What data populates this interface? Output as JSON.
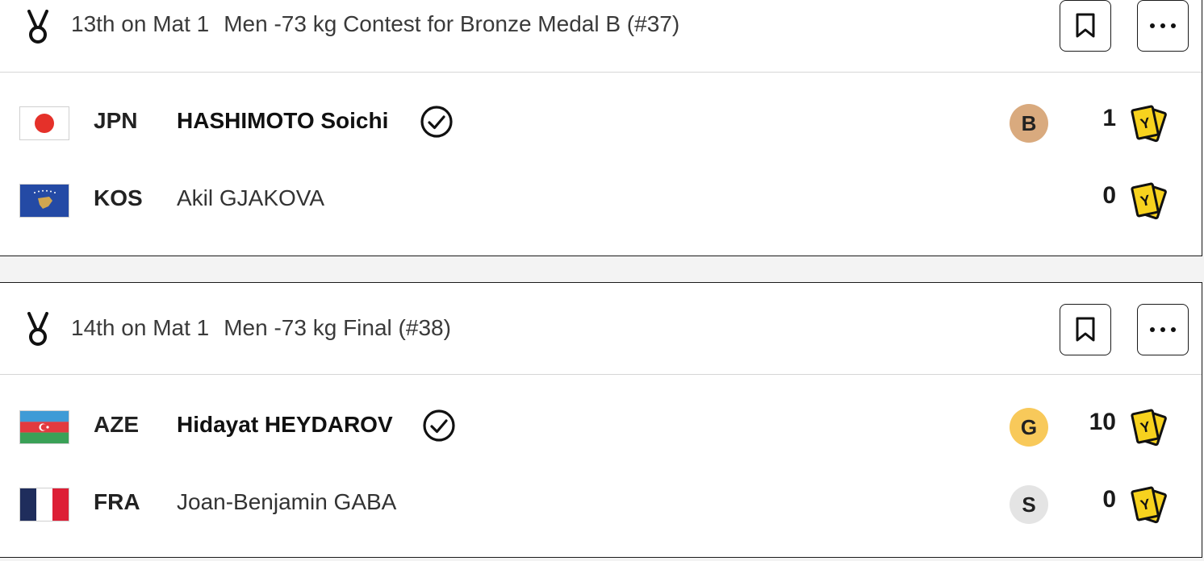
{
  "contests": [
    {
      "order": "13th on Mat 1",
      "title": "Men -73 kg Contest for Bronze Medal B (#37)",
      "athletes": [
        {
          "country": "JPN",
          "name": "HASHIMOTO Soichi",
          "winner": true,
          "medal": "B",
          "score": "1",
          "card": "Y"
        },
        {
          "country": "KOS",
          "name": "Akil GJAKOVA",
          "winner": false,
          "medal": "",
          "score": "0",
          "card": "Y"
        }
      ]
    },
    {
      "order": "14th on Mat 1",
      "title": "Men -73 kg Final (#38)",
      "athletes": [
        {
          "country": "AZE",
          "name": "Hidayat HEYDAROV",
          "winner": true,
          "medal": "G",
          "score": "10",
          "card": "Y"
        },
        {
          "country": "FRA",
          "name": "Joan-Benjamin GABA",
          "winner": false,
          "medal": "S",
          "score": "0",
          "card": "Y"
        }
      ]
    }
  ],
  "colors": {
    "bronze": "#d9aa7e",
    "gold": "#f8c95a",
    "silver": "#e4e4e4",
    "yellow_card": "#f7d21e",
    "border": "#1a1a1a"
  },
  "icons": {
    "header": "medal-icon",
    "bookmark": "bookmark-icon",
    "more": "more-icon",
    "winner": "check-circle-icon",
    "penalty": "yellow-card-icon"
  }
}
